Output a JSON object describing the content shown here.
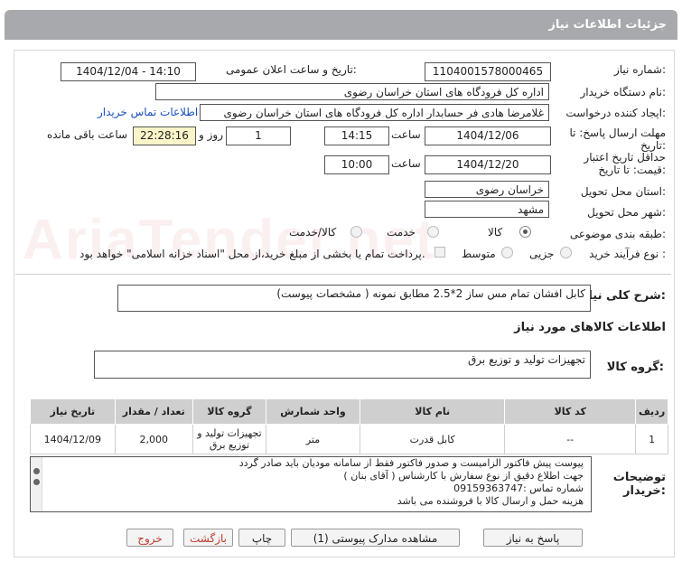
{
  "header": {
    "title": "جزئیات اطلاعات نیاز"
  },
  "watermark": "AriaTender.net",
  "fields": {
    "need_number_label": "شماره نیاز:",
    "need_number": "1104001578000465",
    "announce_label": "تاریخ و ساعت اعلان عمومی:",
    "announce_value": "1404/12/04 - 14:10",
    "buyer_org_label": "نام دستگاه خریدار:",
    "buyer_org": "اداره کل فرودگاه های استان خراسان رضوی",
    "requester_label": "ایجاد کننده درخواست:",
    "requester": "غلامرضا هادی فر حسابدار اداره کل فرودگاه های استان خراسان رضوی",
    "contact_link": "اطلاعات تماس خریدار",
    "deadline_label_1": "مهلت ارسال پاسخ: تا",
    "deadline_label_2": "تاریخ:",
    "deadline_date": "1404/12/06",
    "time_label": "ساعت",
    "deadline_time": "14:15",
    "days_value": "1",
    "days_label": "روز و",
    "remaining_time": "22:28:16",
    "remaining_label": "ساعت باقی مانده",
    "validity_label_1": "حداقل تاریخ اعتبار",
    "validity_label_2": "قیمت: تا تاریخ:",
    "validity_date": "1404/12/20",
    "validity_time_label": "ساعت",
    "validity_time": "10:00",
    "province_label": "استان محل تحویل:",
    "province": "خراسان رضوی",
    "city_label": "شهر محل تحویل:",
    "city": "مشهد",
    "category_label": "طبقه بندی موضوعی:",
    "cat_goods": "کالا",
    "cat_service": "خدمت",
    "cat_goods_service": "کالا/خدمت",
    "process_label": "نوع فرآیند خرید :",
    "proc_partial": "جزیی",
    "proc_medium": "متوسط",
    "payment_note": "پرداخت تمام یا بخشی از مبلغ خرید،از محل \"اسناد خزانه اسلامی\" خواهد بود."
  },
  "summary": {
    "label": "شرح کلی نیاز:",
    "value": "کابل افشان تمام مس ساز 2*2.5 مطابق نمونه ( مشخصات پیوست)"
  },
  "goods_info": {
    "title": "اطلاعات کالاهای مورد نیاز",
    "group_label": "گروه کالا:",
    "group_value": "تجهیزات تولید و توزیع برق"
  },
  "table": {
    "headers": [
      "ردیف",
      "کد کالا",
      "نام کالا",
      "واحد شمارش",
      "گروه کالا",
      "تعداد / مقدار",
      "تاریخ نیاز"
    ],
    "rows": [
      [
        "1",
        "--",
        "کابل قدرت",
        "متر",
        "تجهیزات تولید و توزیع برق",
        "2,000",
        "1404/12/09"
      ]
    ]
  },
  "buyer_notes": {
    "label_1": "توضیحات",
    "label_2": "خریدار:",
    "lines": [
      "پیوست پیش فاکتور الزامیست و صدور فاکتور فقط از سامانه مودیان باید صادر گردد",
      "جهت اطلاع دقیق از نوع سفارش با کارشناس  ( آقای بنان )",
      "شماره تماس :09159363747",
      "هزینه حمل و ارسال کالا با فروشنده می باشد"
    ]
  },
  "buttons": {
    "reply": "پاسخ به نیاز",
    "attachments": "مشاهده مدارک پیوستی (1)",
    "print": "چاپ",
    "back": "بازگشت",
    "exit": "خروج"
  }
}
